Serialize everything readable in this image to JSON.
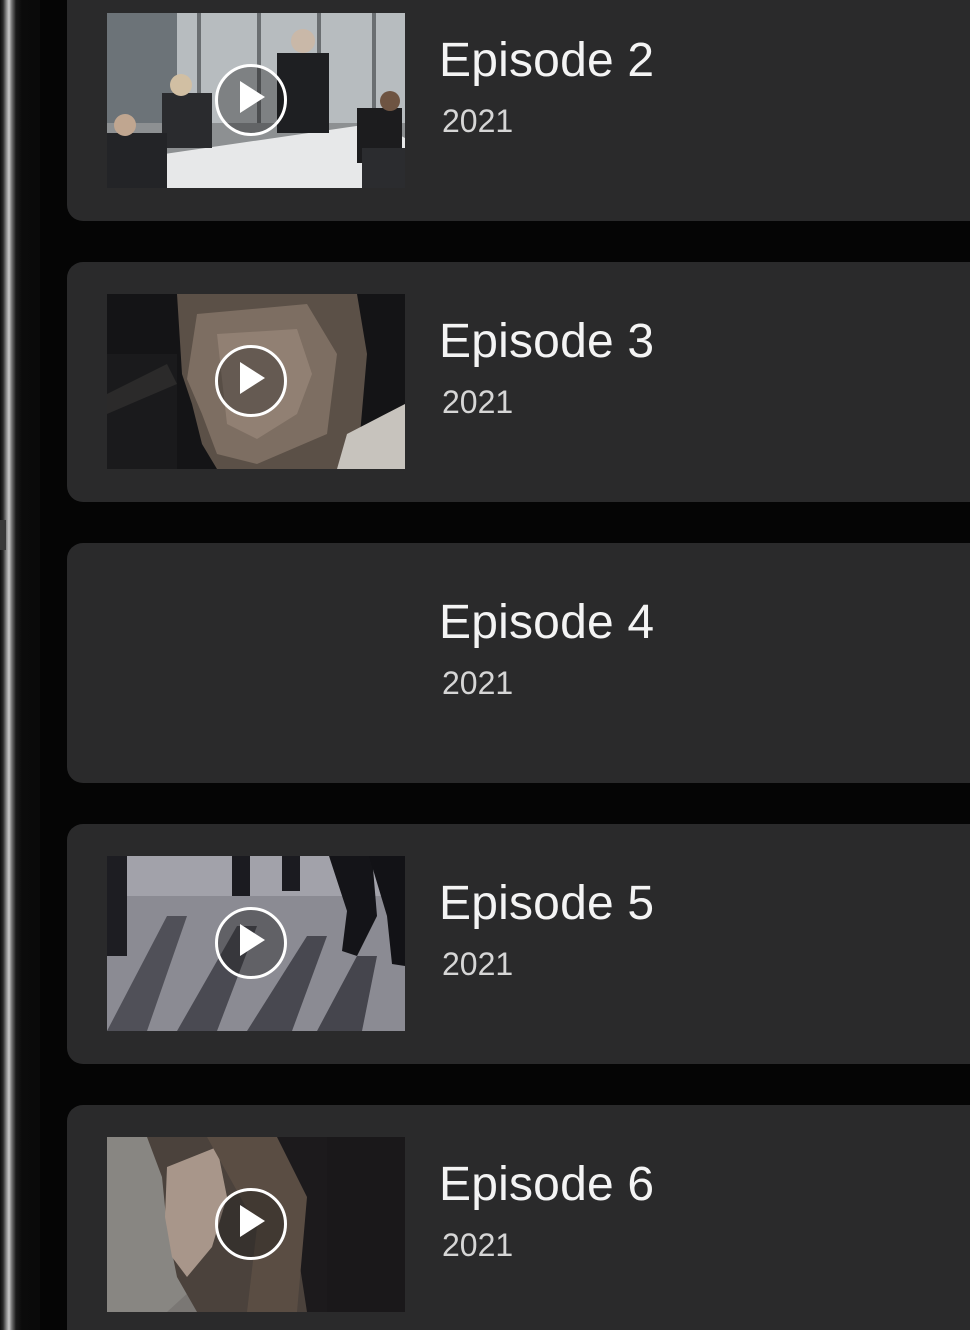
{
  "episodes": [
    {
      "title": "Episode 2",
      "year": "2021",
      "thumbnail": "boardroom-meeting",
      "has_thumbnail": true
    },
    {
      "title": "Episode 3",
      "year": "2021",
      "thumbnail": "man-profile-portrait",
      "has_thumbnail": true
    },
    {
      "title": "Episode 4",
      "year": "2021",
      "thumbnail": "",
      "has_thumbnail": false
    },
    {
      "title": "Episode 5",
      "year": "2021",
      "thumbnail": "people-walking-shadows",
      "has_thumbnail": true
    },
    {
      "title": "Episode 6",
      "year": "2021",
      "thumbnail": "woman-profile-portrait",
      "has_thumbnail": true
    }
  ],
  "icons": {
    "play": "play-icon"
  },
  "colors": {
    "background": "#050505",
    "card": "#2a2a2b",
    "title": "#f4f4f4",
    "year": "#d6d6d6"
  }
}
